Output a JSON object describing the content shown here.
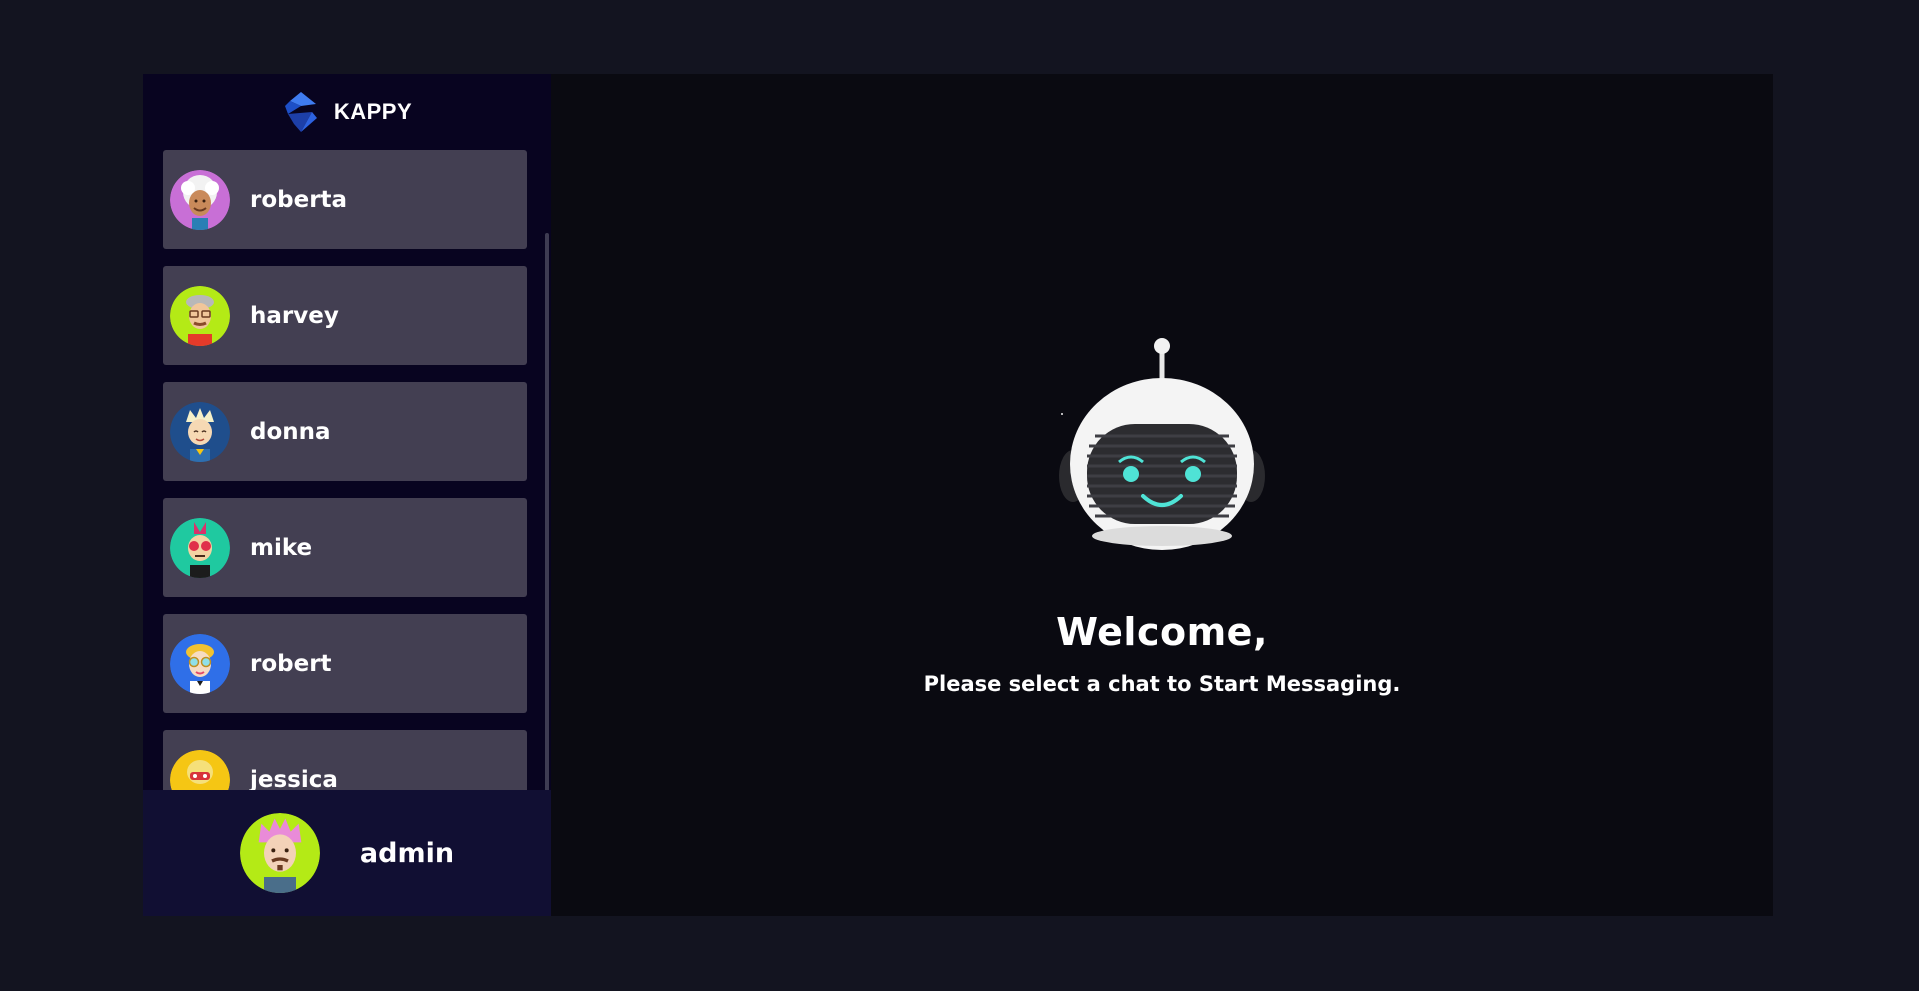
{
  "brand": {
    "name": "KAPPY",
    "logo_icon": "kappy-logo-icon"
  },
  "contacts": [
    {
      "name": "roberta",
      "avatar_bg": "#c86fd6",
      "avatar_icon": "roberta-avatar-icon"
    },
    {
      "name": "harvey",
      "avatar_bg": "#b4ea16",
      "avatar_icon": "harvey-avatar-icon"
    },
    {
      "name": "donna",
      "avatar_bg": "#1f4e8c",
      "avatar_icon": "donna-avatar-icon"
    },
    {
      "name": "mike",
      "avatar_bg": "#1fc9a0",
      "avatar_icon": "mike-avatar-icon"
    },
    {
      "name": "robert",
      "avatar_bg": "#2f6fe8",
      "avatar_icon": "robert-avatar-icon"
    },
    {
      "name": "jessica",
      "avatar_bg": "#f5c614",
      "avatar_icon": "jessica-avatar-icon"
    }
  ],
  "current_user": {
    "name": "admin",
    "avatar_bg": "#b4ea16",
    "avatar_icon": "admin-avatar-icon"
  },
  "welcome": {
    "title": "Welcome,",
    "subtitle": "Please select a chat to Start Messaging.",
    "robot_icon": "robot-icon"
  },
  "colors": {
    "background": "#131420",
    "sidebar": "#080420",
    "contact_card": "#433f52",
    "current_user_bar": "#110f33",
    "main": "#0a0a11",
    "robot_eyes": "#4fe3d6"
  }
}
